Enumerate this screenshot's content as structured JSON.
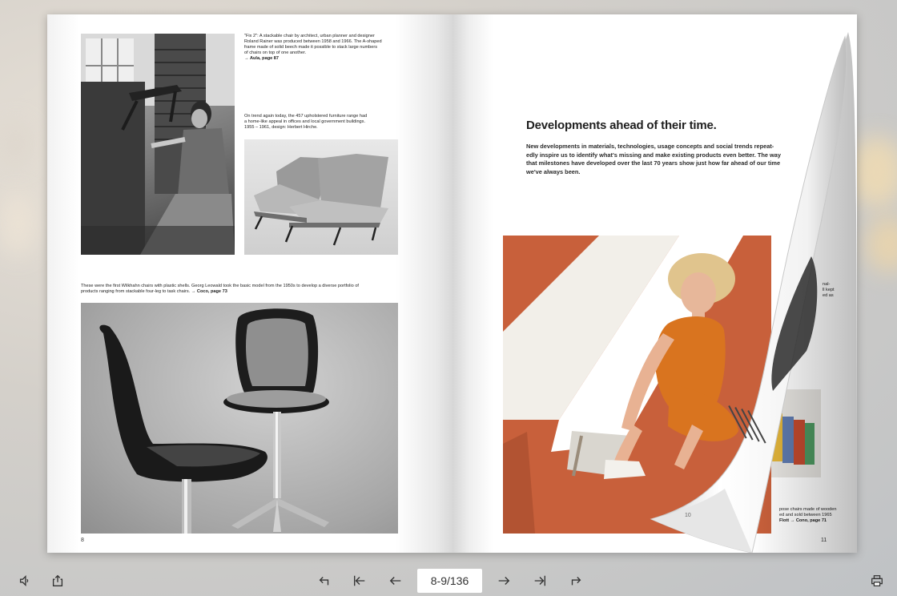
{
  "left_page": {
    "caption_1": [
      "\"Fix 2\": A stackable chair by architect, urban planner and designer",
      "Roland Rainer was produced between 1958 and 1966. The A-shaped",
      "frame made of solid beech made it possible to stack large numbers",
      "of chairs on top of one another."
    ],
    "caption_1_link": "→ Aula, page 87",
    "caption_2": [
      "On trend again today, the 457 upholstered furniture range had",
      "a home-like appeal in offices and local government buildings.",
      "1955 – 1961, design: Herbert Hirche."
    ],
    "caption_3": [
      "These were the first Wilkhahn chairs with plastic shells. Georg Leowald took the basic model from the 1950s to develop a diverse portfolio of",
      "products ranging from stackable four-leg to task chairs."
    ],
    "caption_3_link": "→ Coco, page 73",
    "page_number": "8"
  },
  "right_page": {
    "heading": "Developments ahead of their time.",
    "intro": [
      "New developments in materials, technologies, usage concepts and social trends repeat-",
      "edly inspire us to identify what's missing and make existing products even better. The way",
      "that milestones have developed over the last 70 years show just how far ahead of our time",
      "we've always been."
    ],
    "partial_caption_1": [
      "nal-",
      "ll kept",
      "ed as"
    ],
    "partial_caption_2": [
      "pose chairs made of wooden",
      "ed and sold between 1965"
    ],
    "partial_caption_2_link": "Flott → Cono, page 71",
    "curl_page_number": "10",
    "page_number": "11"
  },
  "toolbar": {
    "page_indicator": "8-9/136",
    "icons": [
      "sound-icon",
      "share-icon",
      "undo-icon",
      "first-page-icon",
      "previous-page-icon",
      "next-page-icon",
      "last-page-icon",
      "redo-icon",
      "print-icon"
    ]
  },
  "colors": {
    "orange_photo": "#c8603b",
    "page_bg": "#ffffff"
  }
}
